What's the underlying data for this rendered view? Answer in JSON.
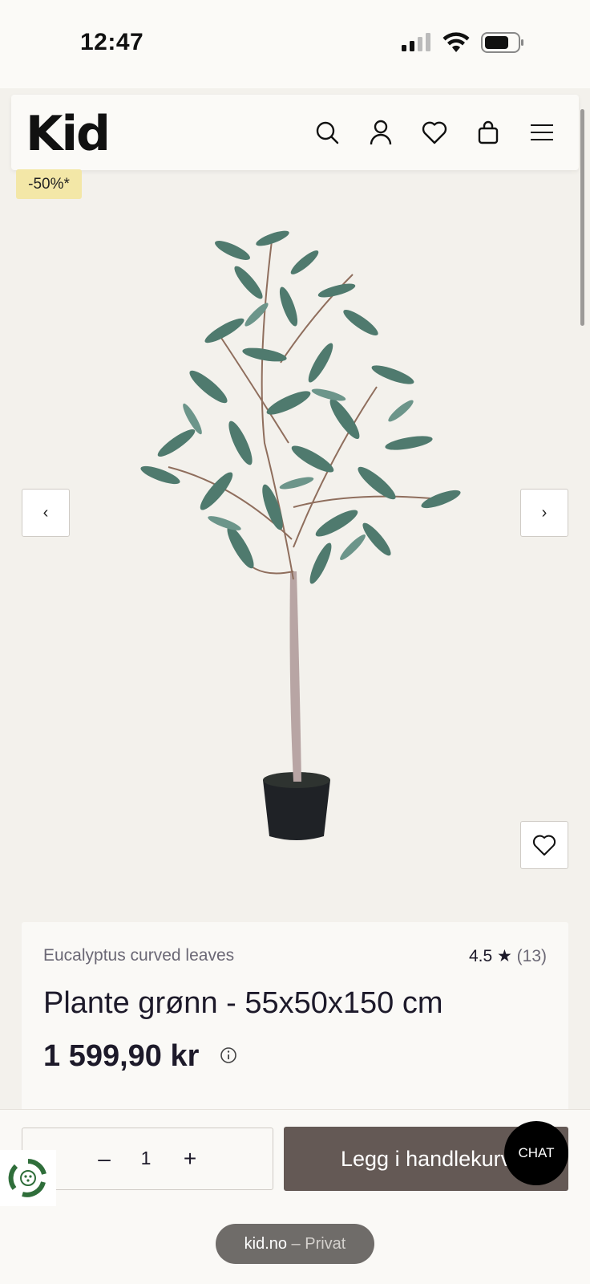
{
  "status_bar": {
    "time": "12:47",
    "icons": [
      "signal-icon",
      "wifi-icon",
      "battery-icon"
    ]
  },
  "header": {
    "logo": "Kid",
    "icons": [
      "search-icon",
      "account-icon",
      "wishlist-icon",
      "cart-icon",
      "menu-icon"
    ]
  },
  "product": {
    "discount_badge": "-50%*",
    "subtitle": "Eucalyptus curved leaves",
    "rating": "4.5 ★",
    "review_count": "(13)",
    "title": "Plante grønn - 55x50x150 cm",
    "price": "1 599,90 kr"
  },
  "gallery": {
    "prev_label": "‹",
    "next_label": "›"
  },
  "purchase": {
    "qty_minus": "–",
    "quantity": "1",
    "qty_plus": "+",
    "add_to_cart": "Legg i handlekurv",
    "chat": "CHAT"
  },
  "browser": {
    "domain": "kid.no",
    "mode": " – Privat"
  },
  "colors": {
    "page_bg": "#f3f1ec",
    "badge_bg": "#f3e7a7",
    "add_button_bg": "#645955",
    "chat_bg": "#000000"
  }
}
